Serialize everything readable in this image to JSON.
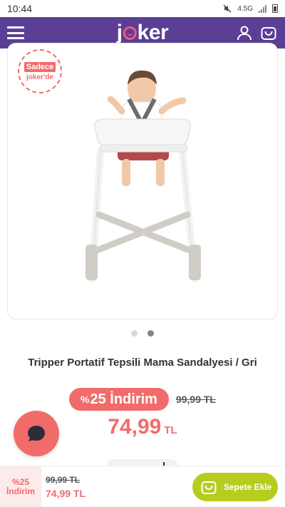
{
  "status_bar": {
    "time": "10:44",
    "network": "4.5G"
  },
  "header": {
    "logo_prefix": "j",
    "logo_suffix": "ker"
  },
  "badge": {
    "line1": "Sadece",
    "line2": "joker'de"
  },
  "product": {
    "title": "Tripper Portatif Tepsili Mama Sandalyesi / Gri",
    "discount_symbol": "%",
    "discount_value": "25",
    "discount_word": "İndirim",
    "old_price": "99,99 TL",
    "new_price": "74,99",
    "currency": "TL"
  },
  "bottom_bar": {
    "discount_line1": "%25",
    "discount_line2": "İndirim",
    "old_price": "99,99 TL",
    "new_price": "74,99 TL",
    "add_to_cart_label": "Sepete Ekle"
  },
  "carousel": {
    "active_index": 1,
    "count": 2
  },
  "colors": {
    "header": "#5b3f95",
    "accent": "#f26b6b",
    "cta": "#b7cc1f"
  }
}
